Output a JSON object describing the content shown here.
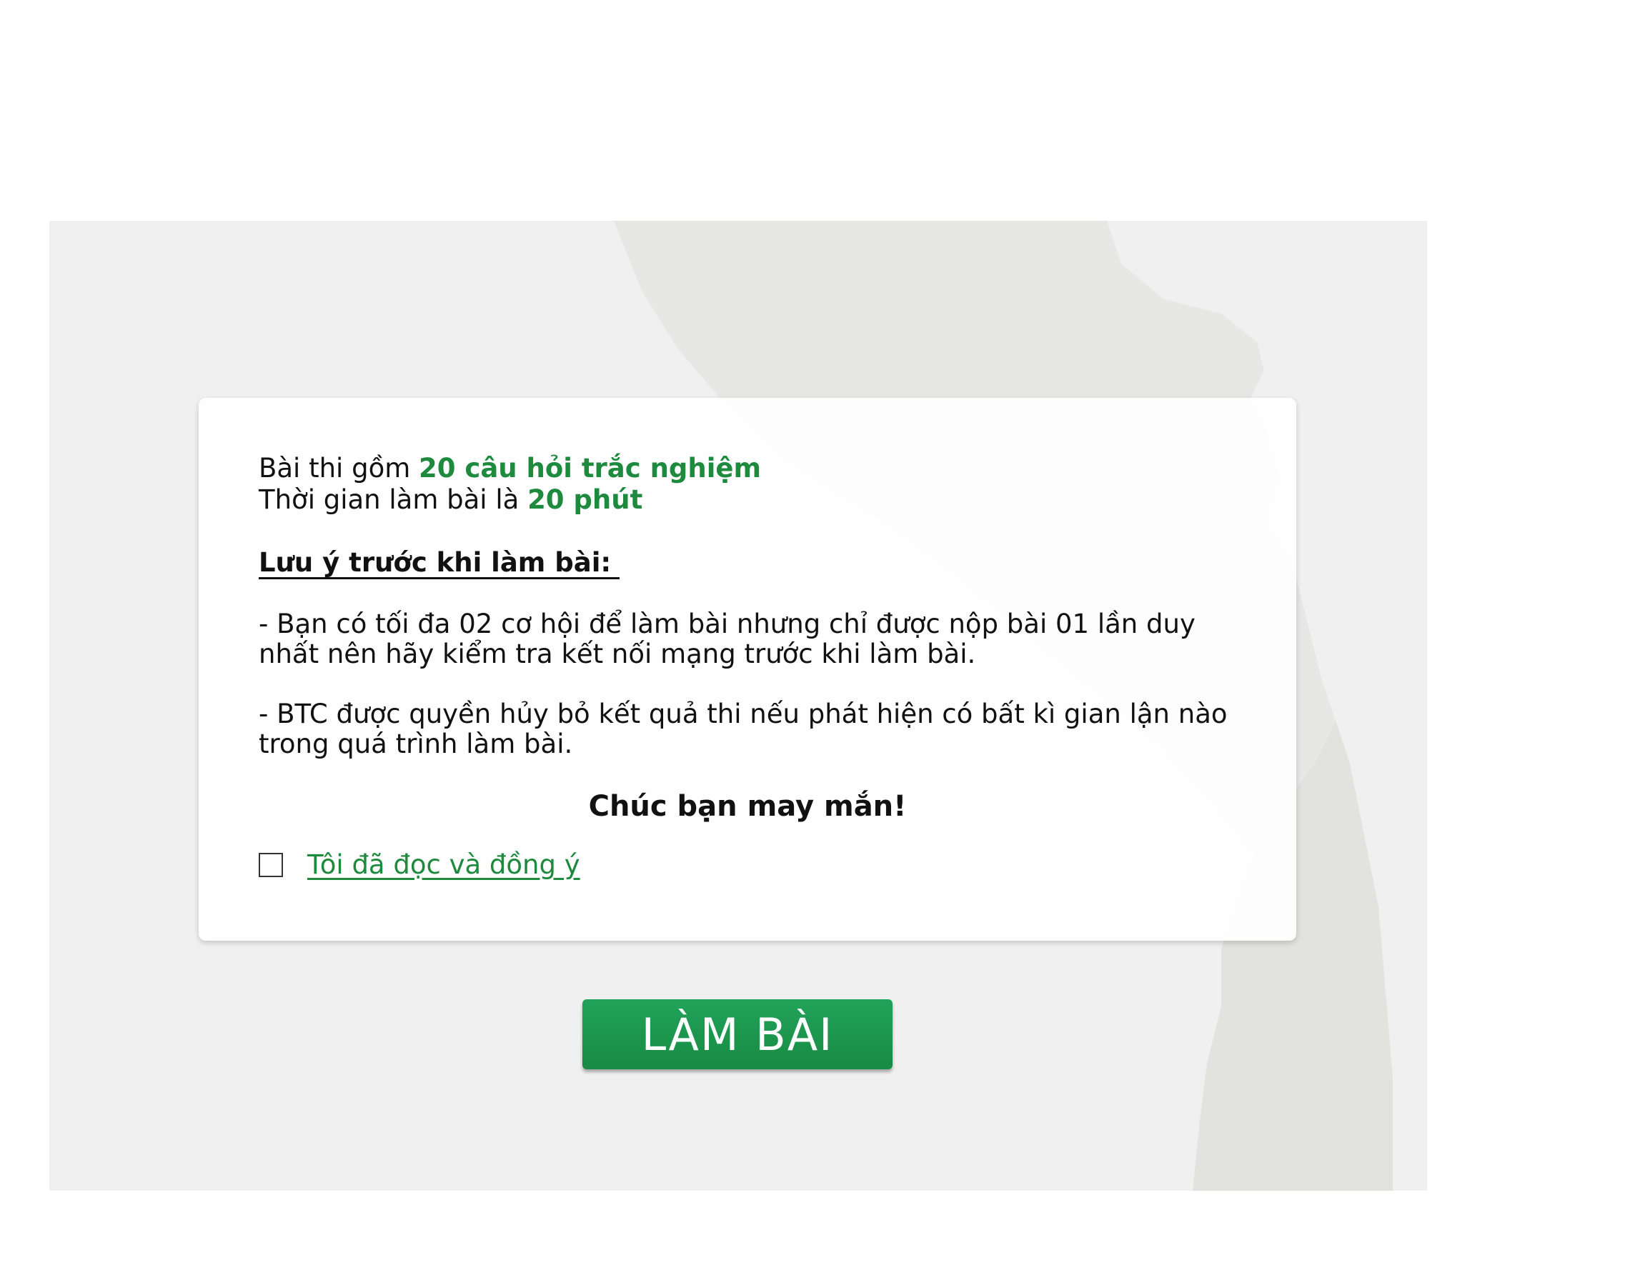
{
  "intro": {
    "line1_prefix": "Bài thi gồm ",
    "line1_highlight": "20 câu hỏi trắc nghiệm",
    "line2_prefix": "Thời gian làm bài là ",
    "line2_highlight": "20 phút"
  },
  "notes": {
    "title": "Lưu ý trước khi làm bài:",
    "items": [
      "- Bạn có tối đa 02 cơ hội để làm bài nhưng chỉ được nộp bài 01 lần duy nhất nên hãy kiểm tra kết nối mạng trước khi làm bài.",
      "- BTC được quyền hủy bỏ kết quả thi nếu phát hiện có bất kì gian lận nào trong quá trình làm bài."
    ]
  },
  "closing": "Chúc bạn may mắn!",
  "agree": {
    "label": "Tôi đã đọc và đồng ý",
    "checked": false
  },
  "start_button": "LÀM BÀI",
  "colors": {
    "accent": "#1e8a3e",
    "button": "#1a9a4e",
    "background": "#f0f0f0"
  }
}
